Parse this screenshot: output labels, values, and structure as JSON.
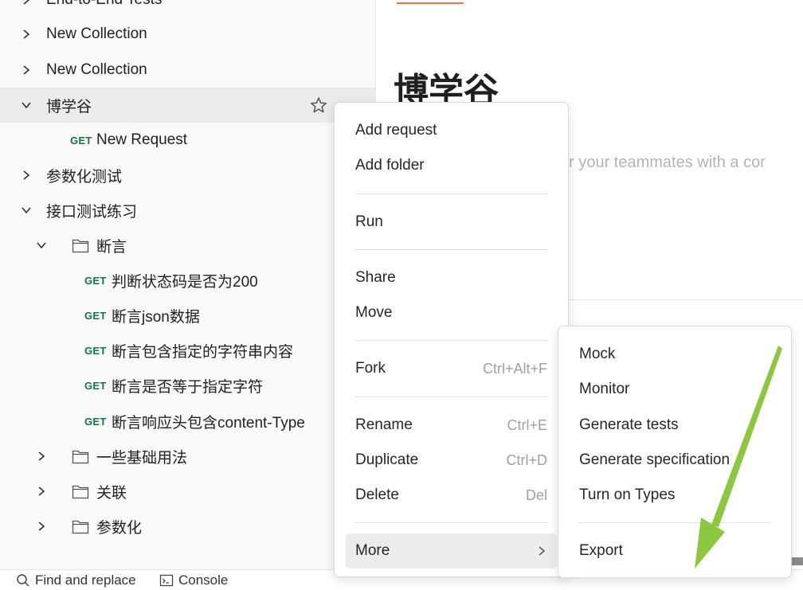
{
  "sidebar": {
    "items": [
      {
        "label": "End-to-End Tests",
        "type": "collection"
      },
      {
        "label": "New Collection",
        "type": "collection"
      },
      {
        "label": "New Collection",
        "type": "collection"
      },
      {
        "label": "博学谷",
        "type": "collection",
        "expanded": true,
        "selected": true
      },
      {
        "method": "GET",
        "label": "New Request",
        "type": "request"
      },
      {
        "label": "参数化测试",
        "type": "collection"
      },
      {
        "label": "接口测试练习",
        "type": "collection",
        "expanded": true
      },
      {
        "label": "断言",
        "type": "folder",
        "expanded": true
      },
      {
        "method": "GET",
        "label": "判断状态码是否为200",
        "type": "request"
      },
      {
        "method": "GET",
        "label": "断言json数据",
        "type": "request"
      },
      {
        "method": "GET",
        "label": "断言包含指定的字符串内容",
        "type": "request"
      },
      {
        "method": "GET",
        "label": "断言是否等于指定字符",
        "type": "request"
      },
      {
        "method": "GET",
        "label": "断言响应头包含content-Type",
        "type": "request"
      },
      {
        "label": "一些基础用法",
        "type": "folder"
      },
      {
        "label": "关联",
        "type": "folder"
      },
      {
        "label": "参数化",
        "type": "folder"
      }
    ]
  },
  "bottombar": {
    "find_replace": "Find and replace",
    "console": "Console"
  },
  "main": {
    "title": "博学谷",
    "description_placeholder": "or your teammates with a cor"
  },
  "context_menu": {
    "add_request": "Add request",
    "add_folder": "Add folder",
    "run": "Run",
    "share": "Share",
    "move": "Move",
    "fork": "Fork",
    "fork_shortcut": "Ctrl+Alt+F",
    "rename": "Rename",
    "rename_shortcut": "Ctrl+E",
    "duplicate": "Duplicate",
    "duplicate_shortcut": "Ctrl+D",
    "delete": "Delete",
    "delete_shortcut": "Del",
    "more": "More"
  },
  "submenu": {
    "mock": "Mock",
    "monitor": "Monitor",
    "generate_tests": "Generate tests",
    "generate_specification": "Generate specification",
    "turn_on_types": "Turn on Types",
    "export": "Export"
  },
  "colors": {
    "get_method": "#0c7c3c",
    "accent": "#ff6c37",
    "annotation_arrow": "#8dc63f"
  }
}
